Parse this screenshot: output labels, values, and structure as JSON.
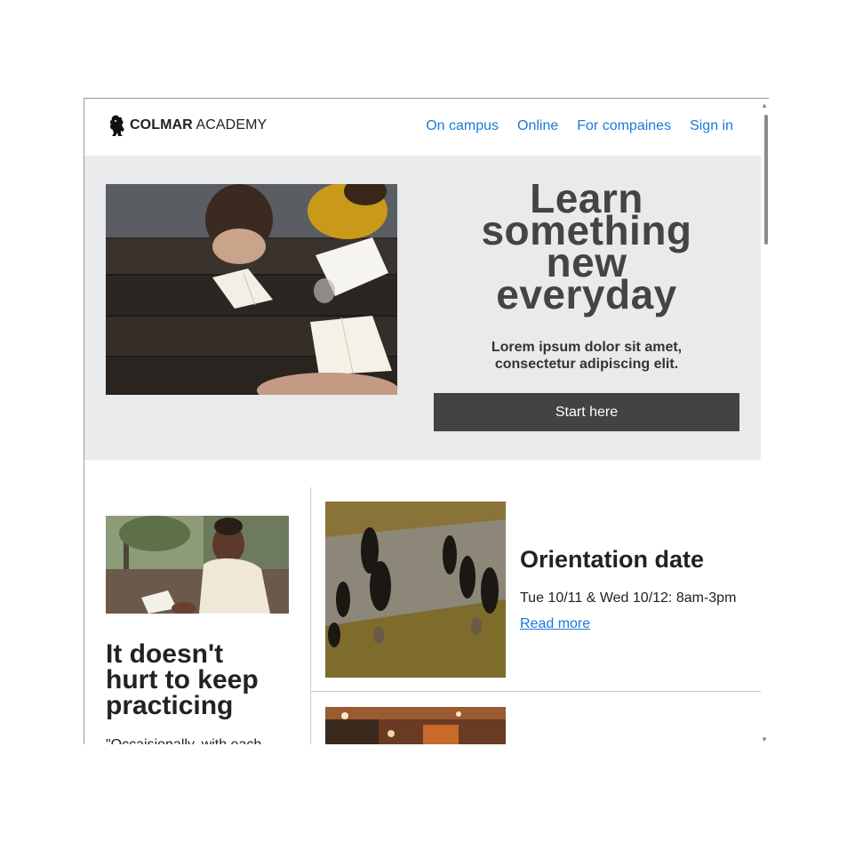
{
  "header": {
    "logo_bold": "COLMAR",
    "logo_rest": " ACADEMY",
    "nav": [
      "On campus",
      "Online",
      "For compaines",
      "Sign in"
    ]
  },
  "hero": {
    "title_lines": [
      "Learn",
      "something",
      "new",
      "everyday"
    ],
    "subtitle_line1": "Lorem ipsum dolor sit amet,",
    "subtitle_line2": "consectetur adipiscing elit.",
    "cta_label": "Start here"
  },
  "side": {
    "title_lines": [
      "It doesn't",
      "hurt to keep",
      "practicing"
    ],
    "quote": "\"Occaisionally, with each"
  },
  "card": {
    "title": "Orientation date",
    "date": "Tue 10/11 & Wed 10/12: 8am-3pm",
    "link": "Read more"
  },
  "colors": {
    "accent": "#1a7ad8",
    "hero_bg": "#e8eaec",
    "button_bg": "#444242"
  }
}
